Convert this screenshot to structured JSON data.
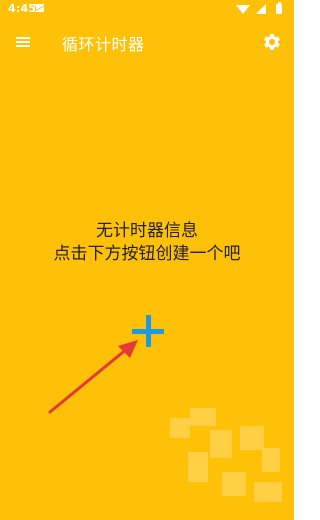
{
  "status_bar": {
    "time": "4:45",
    "icons": [
      "mail-icon",
      "wifi-icon",
      "signal-icon",
      "battery-icon"
    ]
  },
  "app_bar": {
    "title": "循环计时器",
    "menu_icon": "menu-icon",
    "settings_icon": "gear-icon"
  },
  "empty_state": {
    "line1": "无计时器信息",
    "line2": "点击下方按钮创建一个吧"
  },
  "actions": {
    "add_icon": "plus-icon"
  },
  "colors": {
    "background": "#FFC107",
    "accent_plus": "#1E9BE0",
    "annotation_arrow": "#E53935",
    "text": "#222222"
  }
}
